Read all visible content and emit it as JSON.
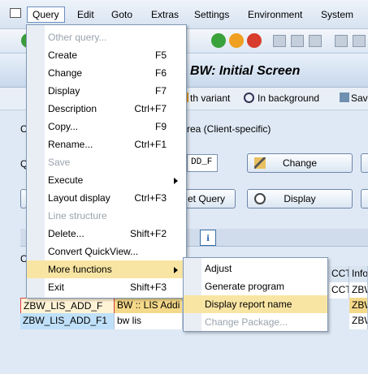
{
  "menubar": {
    "items": [
      "Query",
      "Edit",
      "Goto",
      "Extras",
      "Settings",
      "Environment",
      "System"
    ]
  },
  "title": "BW: Initial Screen",
  "appbar": {
    "variant_label": "th variant",
    "background_label": "In background",
    "save_label": "Sav"
  },
  "area_text": "rea (Client-specific)",
  "partial_labels": {
    "q": "Q",
    "c": "C",
    "c2": "C"
  },
  "query_input_value": "DD_F",
  "buttons": {
    "change": "Change",
    "display": "Display",
    "set_query": "et Query"
  },
  "grid": {
    "hdr_partial_1": "CCT",
    "hdr_partial_2": "Info",
    "rows": [
      {
        "name": "ZBW_LIS_ADD_F",
        "title": "BW :: LIS Addi",
        "tail": "ZBW"
      },
      {
        "name": "ZBW_LIS_ADD_F1",
        "title": "bw lis",
        "tail": "ZBW"
      }
    ],
    "tail_row0": "ZBW"
  },
  "query_menu": {
    "items": [
      {
        "label": "Other query...",
        "shortcut": "",
        "disabled": true
      },
      {
        "label": "Create",
        "shortcut": "F5",
        "disabled": false
      },
      {
        "label": "Change",
        "shortcut": "F6",
        "disabled": false
      },
      {
        "label": "Display",
        "shortcut": "F7",
        "disabled": false
      },
      {
        "label": "Description",
        "shortcut": "Ctrl+F7",
        "disabled": false
      },
      {
        "label": "Copy...",
        "shortcut": "F9",
        "disabled": false
      },
      {
        "label": "Rename...",
        "shortcut": "Ctrl+F1",
        "disabled": false
      },
      {
        "label": "Save",
        "shortcut": "",
        "disabled": true
      },
      {
        "label": "Execute",
        "shortcut": "",
        "disabled": false,
        "submenu": true
      },
      {
        "label": "Layout display",
        "shortcut": "Ctrl+F3",
        "disabled": false
      },
      {
        "label": "Line structure",
        "shortcut": "",
        "disabled": true
      },
      {
        "label": "Delete...",
        "shortcut": "Shift+F2",
        "disabled": false
      },
      {
        "label": "Convert QuickView...",
        "shortcut": "",
        "disabled": false
      },
      {
        "label": "More functions",
        "shortcut": "",
        "disabled": false,
        "submenu": true,
        "highlighted": true
      },
      {
        "label": "Exit",
        "shortcut": "Shift+F3",
        "disabled": false
      }
    ]
  },
  "more_functions_menu": {
    "items": [
      {
        "label": "Adjust",
        "disabled": false
      },
      {
        "label": "Generate program",
        "disabled": false
      },
      {
        "label": "Display report name",
        "disabled": false,
        "highlighted": true
      },
      {
        "label": "Change Package...",
        "disabled": true
      }
    ]
  },
  "colors": {
    "highlight": "#f9e5a3",
    "menu_border": "#8298b6",
    "selected_row": "#f5d98a",
    "blue_row": "#bfe0f8"
  }
}
